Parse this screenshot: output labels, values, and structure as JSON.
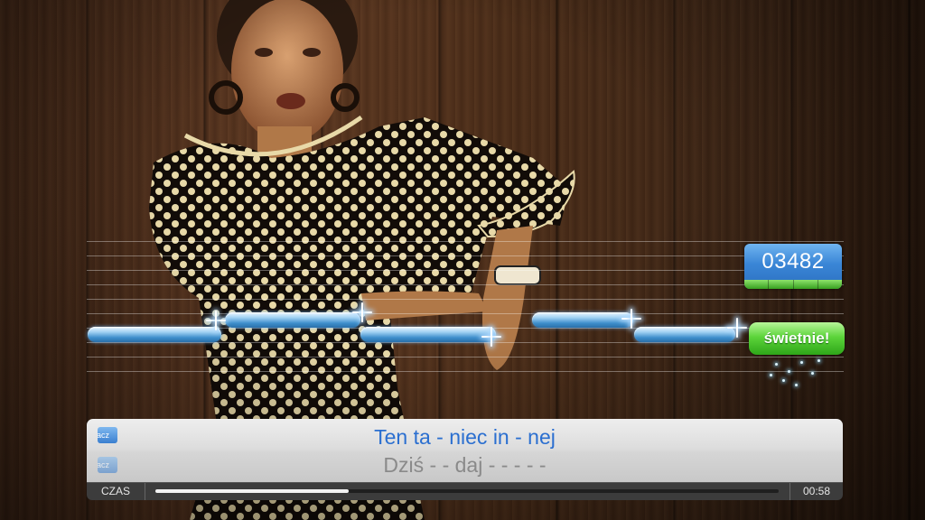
{
  "score": {
    "value": "03482",
    "bar_color": "#5bd13a",
    "box_color": "#3a86d6"
  },
  "rating": {
    "text": "świetnie!",
    "color": "#4fcc2e"
  },
  "lyrics": {
    "current": "Ten ta - niec  in - nej",
    "next": "Dziś - - daj - -  - - -",
    "player_tag": "racz",
    "current_color": "#2b6fd0",
    "next_color": "#8a8a8a"
  },
  "timebar": {
    "label": "CZAS",
    "remaining": "00:58",
    "progress": 0.31
  },
  "notes_colors": {
    "note": "#4a9ad6"
  }
}
